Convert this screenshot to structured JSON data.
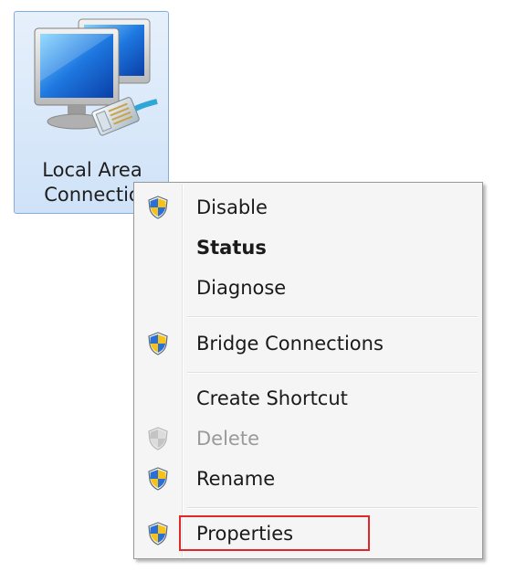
{
  "network_item": {
    "label_line1": "Local Area",
    "label_line2": "Connectio",
    "icon": "network-connection-icon",
    "selected": true
  },
  "context_menu": {
    "items": [
      {
        "label": "Disable",
        "icon": "uac-shield-icon",
        "style": "normal"
      },
      {
        "label": "Status",
        "icon": null,
        "style": "bold"
      },
      {
        "label": "Diagnose",
        "icon": null,
        "style": "normal"
      },
      {
        "label": "Bridge Connections",
        "icon": "uac-shield-icon",
        "style": "normal"
      },
      {
        "label": "Create Shortcut",
        "icon": null,
        "style": "normal"
      },
      {
        "label": "Delete",
        "icon": "uac-shield-icon",
        "style": "disabled"
      },
      {
        "label": "Rename",
        "icon": "uac-shield-icon",
        "style": "normal"
      },
      {
        "label": "Properties",
        "icon": "uac-shield-icon",
        "style": "normal"
      }
    ]
  },
  "annotation": {
    "highlight_color": "#e0272c",
    "highlighted_item": "Properties"
  }
}
